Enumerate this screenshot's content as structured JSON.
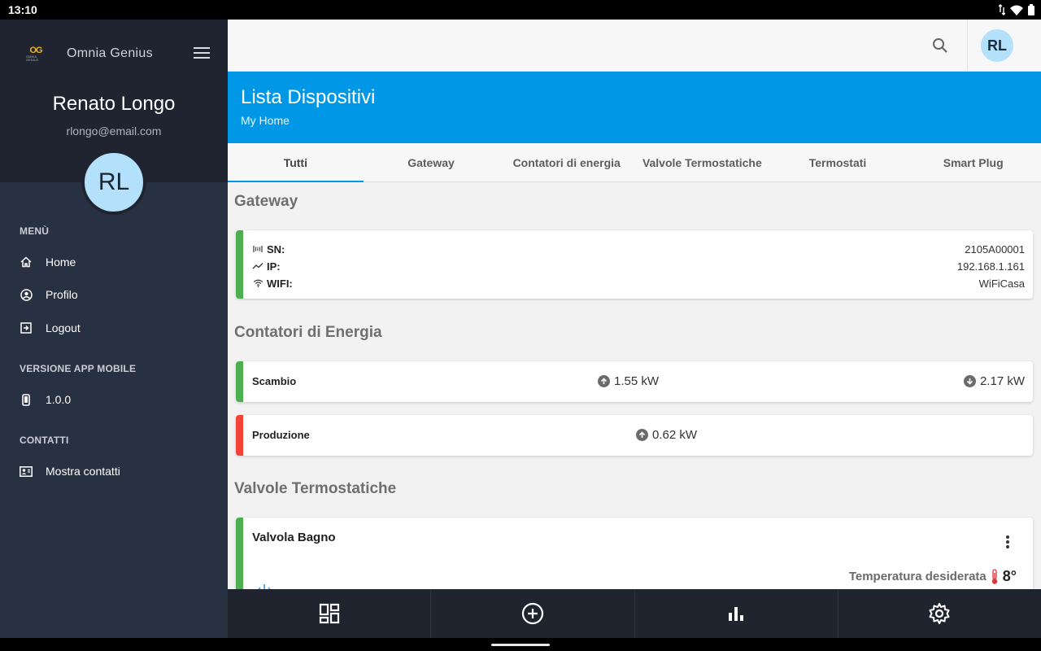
{
  "status_bar": {
    "time": "13:10"
  },
  "sidebar": {
    "brand": {
      "logo_text": "OG",
      "logo_subtext": "OMNIA GENIUS",
      "name": "Omnia Genius"
    },
    "user": {
      "name": "Renato Longo",
      "email": "rlongo@email.com",
      "initials": "RL"
    },
    "menu_section": "MENÙ",
    "menu_items": [
      {
        "label": "Home",
        "icon": "home-icon"
      },
      {
        "label": "Profilo",
        "icon": "account-circle-icon"
      },
      {
        "label": "Logout",
        "icon": "logout-icon"
      }
    ],
    "version_section": "VERSIONE APP MOBILE",
    "version": "1.0.0",
    "contacts_section": "CONTATTI",
    "contacts_item": "Mostra contatti"
  },
  "topbar": {
    "avatar_initials": "RL"
  },
  "header": {
    "title": "Lista Dispositivi",
    "subtitle": "My Home",
    "color": "#0098e6"
  },
  "tabs": [
    {
      "label": "Tutti",
      "active": true
    },
    {
      "label": "Gateway",
      "active": false
    },
    {
      "label": "Contatori di energia",
      "active": false
    },
    {
      "label": "Valvole Termostatiche",
      "active": false
    },
    {
      "label": "Termostati",
      "active": false
    },
    {
      "label": "Smart Plug",
      "active": false
    }
  ],
  "gateway": {
    "section_title": "Gateway",
    "rows": [
      {
        "label": "SN:",
        "value": "2105A00001",
        "icon": "serial-icon"
      },
      {
        "label": "IP:",
        "value": "192.168.1.161",
        "icon": "trend-icon"
      },
      {
        "label": "WIFI:",
        "value": "WiFiCasa",
        "icon": "wifi-icon"
      }
    ]
  },
  "energy": {
    "section_title": "Contatori di Energia",
    "scambio": {
      "name": "Scambio",
      "up": "1.55 kW",
      "down": "2.17 kW"
    },
    "produzione": {
      "name": "Produzione",
      "up": "0.62 kW"
    }
  },
  "valves": {
    "section_title": "Valvole Termostatiche",
    "valve": {
      "name": "Valvola Bagno",
      "temp_label": "Temperatura desiderata",
      "temp_value": "8°"
    }
  },
  "colors": {
    "green": "#4caf50",
    "red": "#f44336",
    "sidebar": "#283142",
    "bottom_nav": "#20242e"
  }
}
